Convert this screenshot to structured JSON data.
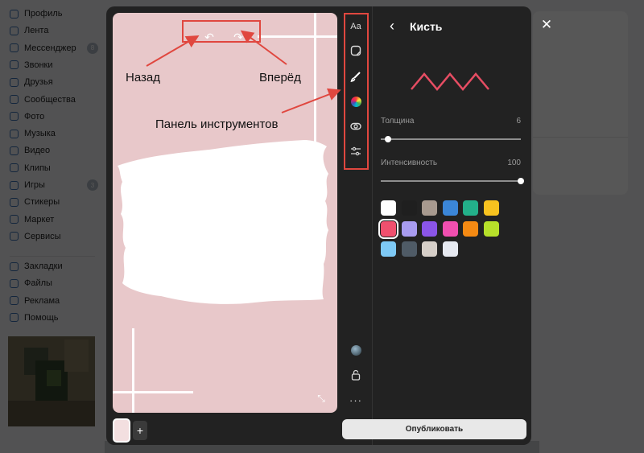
{
  "background": {
    "sidebar": [
      {
        "label": "Профиль",
        "count": ""
      },
      {
        "label": "Лента",
        "count": ""
      },
      {
        "label": "Мессенджер",
        "count": "8"
      },
      {
        "label": "Звонки",
        "count": ""
      },
      {
        "label": "Друзья",
        "count": ""
      },
      {
        "label": "Сообщества",
        "count": ""
      },
      {
        "label": "Фото",
        "count": ""
      },
      {
        "label": "Музыка",
        "count": ""
      },
      {
        "label": "Видео",
        "count": ""
      },
      {
        "label": "Клипы",
        "count": ""
      },
      {
        "label": "Игры",
        "count": "3"
      },
      {
        "label": "Стикеры",
        "count": ""
      },
      {
        "label": "Маркет",
        "count": ""
      },
      {
        "label": "Сервисы",
        "count": ""
      },
      {
        "label": "Закладки",
        "count": ""
      },
      {
        "label": "Файлы",
        "count": ""
      },
      {
        "label": "Реклама",
        "count": ""
      },
      {
        "label": "Помощь",
        "count": ""
      }
    ]
  },
  "annotations": {
    "undo_label": "Назад",
    "redo_label": "Вперёд",
    "toolbar_label": "Панель инструментов"
  },
  "tools": {
    "text": "Aa"
  },
  "panel": {
    "title": "Кисть",
    "thickness_label": "Толщина",
    "thickness_value": "6",
    "thickness_fraction": 0.05,
    "intensity_label": "Интенсивность",
    "intensity_value": "100",
    "intensity_fraction": 1.0,
    "preview_color": "#e64d63",
    "swatches": [
      "#ffffff",
      "#1f1f1f",
      "#a89a8f",
      "#3b86d8",
      "#23b08a",
      "#f7c21f",
      "#f0506e",
      "#a89cf0",
      "#8a55e8",
      "#f04fb0",
      "#f58a13",
      "#b6e02a",
      "#7ec9f5",
      "#4f5b66",
      "#d6cfc8",
      "#e6e9f0"
    ],
    "selected_swatch": 6
  },
  "bottom": {
    "publish_label": "Опубликовать",
    "add_label": "+"
  },
  "colors": {
    "canvas_bg": "#e8c8ca",
    "annotation_red": "#e0473f"
  }
}
